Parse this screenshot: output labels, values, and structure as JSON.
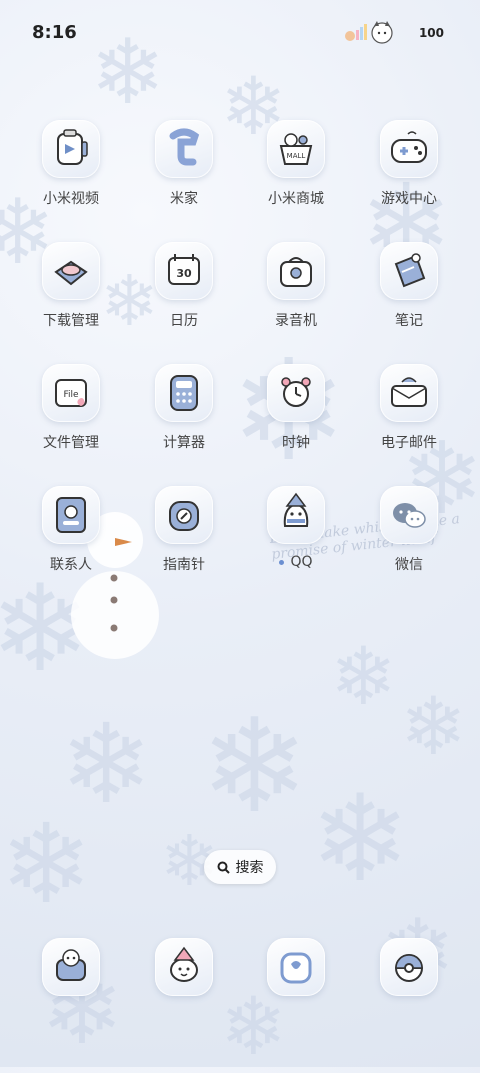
{
  "status_bar": {
    "time": "8:16",
    "battery": "100"
  },
  "apps": [
    {
      "label": "小米视频",
      "icon": "video-icon"
    },
    {
      "label": "米家",
      "icon": "mijia-icon"
    },
    {
      "label": "小米商城",
      "icon": "mall-icon"
    },
    {
      "label": "游戏中心",
      "icon": "gamepad-icon"
    },
    {
      "label": "下载管理",
      "icon": "download-icon"
    },
    {
      "label": "日历",
      "icon": "calendar-icon",
      "day": "30"
    },
    {
      "label": "录音机",
      "icon": "recorder-icon"
    },
    {
      "label": "笔记",
      "icon": "notes-icon"
    },
    {
      "label": "文件管理",
      "icon": "file-icon",
      "text": "File"
    },
    {
      "label": "计算器",
      "icon": "calculator-icon"
    },
    {
      "label": "时钟",
      "icon": "clock-icon"
    },
    {
      "label": "电子邮件",
      "icon": "mail-icon"
    },
    {
      "label": "联系人",
      "icon": "contacts-icon"
    },
    {
      "label": "指南针",
      "icon": "compass-icon"
    },
    {
      "label": "QQ",
      "icon": "qq-icon"
    },
    {
      "label": "微信",
      "icon": "wechat-icon"
    }
  ],
  "search": {
    "label": "搜索"
  },
  "dock": [
    {
      "icon": "phone-icon"
    },
    {
      "icon": "messages-icon"
    },
    {
      "icon": "camera-icon"
    },
    {
      "icon": "browser-icon"
    }
  ],
  "wallpaper_text": "Every flake whispers like a promise of winter itself"
}
